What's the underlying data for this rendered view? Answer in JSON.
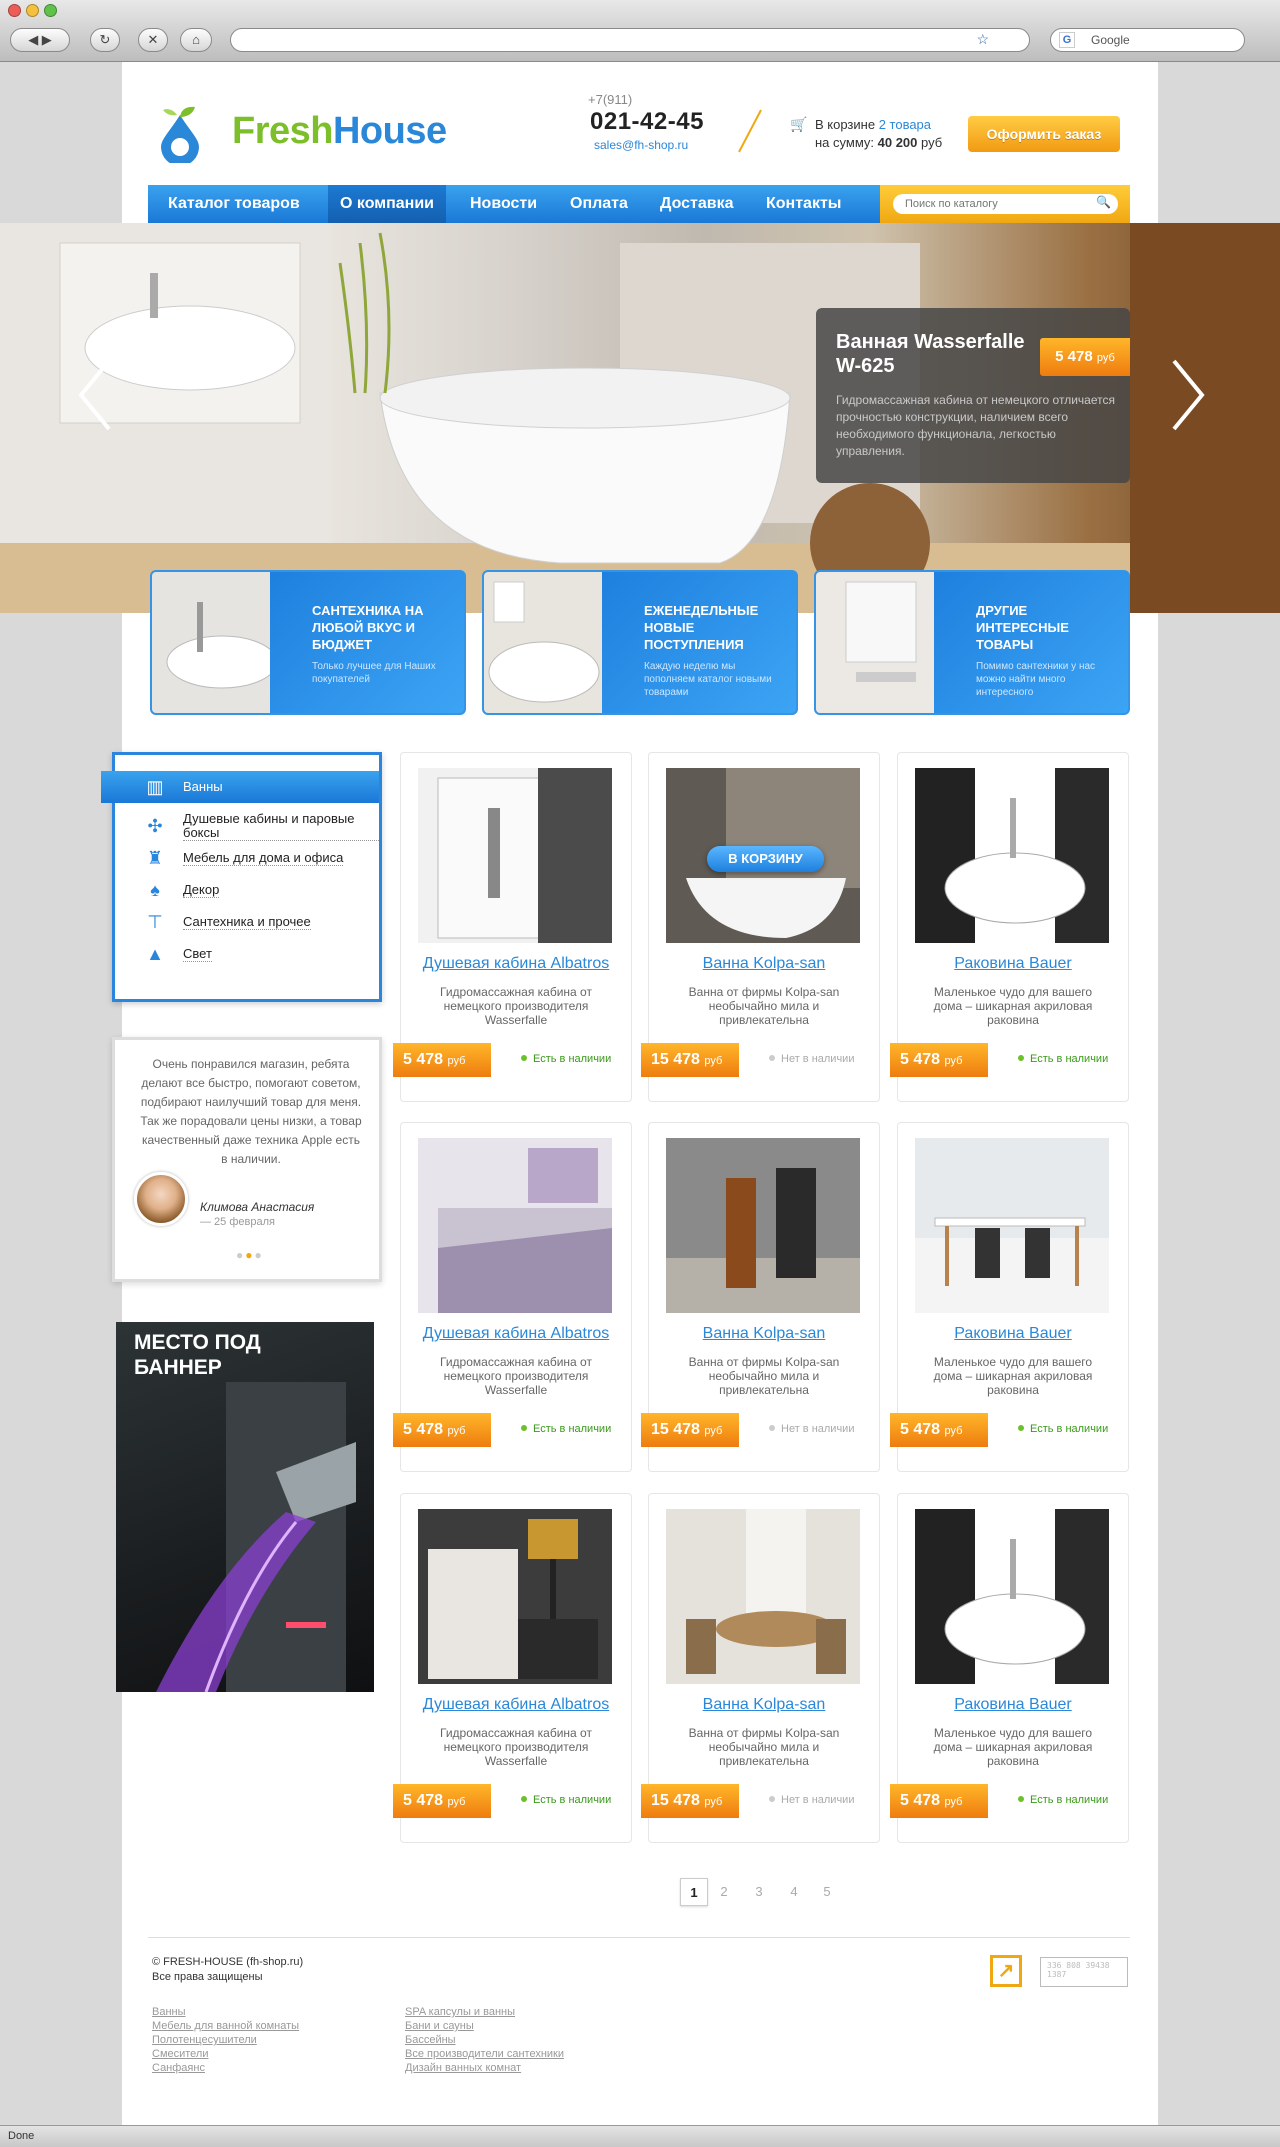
{
  "browser": {
    "search_placeholder": "Google",
    "status": "Done"
  },
  "header": {
    "logo_fresh": "Fresh",
    "logo_house": "House",
    "phone_prefix": "+7(911)",
    "phone": "021-42-45",
    "email": "sales@fh-shop.ru",
    "cart_line1_prefix": "В корзине ",
    "cart_items": "2 товара",
    "cart_line2_prefix": "на сумму: ",
    "cart_sum": "40 200",
    "cart_currency": " руб",
    "order_button": "Оформить заказ"
  },
  "nav": {
    "items": [
      {
        "label": "Каталог товаров"
      },
      {
        "label": "О компании"
      },
      {
        "label": "Новости"
      },
      {
        "label": "Оплата"
      },
      {
        "label": "Доставка"
      },
      {
        "label": "Контакты"
      }
    ],
    "active": "О компании",
    "search_placeholder": "Поиск по каталогу"
  },
  "hero": {
    "title": "Ванная Wasserfalle W-625",
    "price": "5 478",
    "currency": "руб",
    "description": "Гидромассажная кабина от немецкого отличается прочностью конструкции, наличием всего необходимого функционала, легкостью управления."
  },
  "tiles": [
    {
      "title": "Сантехника на любой вкус и бюджет",
      "subtitle": "Только лучшее для Наших покупателей"
    },
    {
      "title": "Еженедельные новые поступления",
      "subtitle": "Каждую неделю мы пополняем каталог новыми товарами"
    },
    {
      "title": "Другие интересные товары",
      "subtitle": "Помимо сантехники у нас можно найти много интересного"
    }
  ],
  "categories": [
    {
      "label": "Ванны",
      "icon": "bath-icon"
    },
    {
      "label": "Душевые кабины и паровые боксы",
      "icon": "fan-icon"
    },
    {
      "label": "Мебель для дома и офиса",
      "icon": "chair-icon"
    },
    {
      "label": "Декор",
      "icon": "lamp-icon"
    },
    {
      "label": "Сантехника и прочее",
      "icon": "faucet-icon"
    },
    {
      "label": "Свет",
      "icon": "light-icon"
    }
  ],
  "review": {
    "text": "Очень понравился магазин, ребята делают все быстро, помогают советом, подбирают наилучший товар для меня. Так же порадовали цены низки, а товар качественный даже техника Apple есть в наличии.",
    "name": "Климова Анастасия",
    "date": "— 25 февраля"
  },
  "banner": {
    "text": "МЕСТО ПОД БАННЕР"
  },
  "to_cart_button": "В КОРЗИНУ",
  "products": [
    {
      "name": "Душевая кабина Albatros",
      "desc": "Гидромассажная кабина от немецкого производителя Wasserfalle",
      "price": "5 478",
      "currency": "руб",
      "stock": "Есть в наличии",
      "in_stock": true
    },
    {
      "name": "Ванна Kolpa-san",
      "desc": "Ванна от фирмы Kolpa-san необычайно мила и привлекательна",
      "price": "15 478",
      "currency": "руб",
      "stock": "Нет в наличии",
      "in_stock": false
    },
    {
      "name": "Раковина Bauer",
      "desc": "Маленькое чудо для вашего дома – шикарная акриловая раковина",
      "price": "5 478",
      "currency": "руб",
      "stock": "Есть в наличии",
      "in_stock": true
    },
    {
      "name": "Душевая кабина Albatros",
      "desc": "Гидромассажная кабина от немецкого производителя Wasserfalle",
      "price": "5 478",
      "currency": "руб",
      "stock": "Есть в наличии",
      "in_stock": true
    },
    {
      "name": "Ванна Kolpa-san",
      "desc": "Ванна от фирмы Kolpa-san необычайно мила и привлекательна",
      "price": "15 478",
      "currency": "руб",
      "stock": "Нет в наличии",
      "in_stock": false
    },
    {
      "name": "Раковина Bauer",
      "desc": "Маленькое чудо для вашего дома – шикарная акриловая раковина",
      "price": "5 478",
      "currency": "руб",
      "stock": "Есть в наличии",
      "in_stock": true
    },
    {
      "name": "Душевая кабина Albatros",
      "desc": "Гидромассажная кабина от немецкого производителя Wasserfalle",
      "price": "5 478",
      "currency": "руб",
      "stock": "Есть в наличии",
      "in_stock": true
    },
    {
      "name": "Ванна Kolpa-san",
      "desc": "Ванна от фирмы Kolpa-san необычайно мила и привлекательна",
      "price": "15 478",
      "currency": "руб",
      "stock": "Нет в наличии",
      "in_stock": false
    },
    {
      "name": "Раковина Bauer",
      "desc": "Маленькое чудо для вашего дома – шикарная акриловая раковина",
      "price": "5 478",
      "currency": "руб",
      "stock": "Есть в наличии",
      "in_stock": true
    }
  ],
  "pagination": [
    "1",
    "2",
    "3",
    "4",
    "5"
  ],
  "pagination_active": "1",
  "footer": {
    "copyright_line1": "© FRESH-HOUSE (fh-shop.ru)",
    "copyright_line2": "Все права защищены",
    "col1": [
      "Ванны",
      "Мебель для ванной комнаты",
      "Полотенцесушители",
      "Смесители",
      "Санфаянс"
    ],
    "col2": [
      "SPA капсулы и ванны",
      "Бани и сауны",
      "Бассейны",
      "Все производители сантехники",
      "Дизайн ванных комнат"
    ],
    "studio_code": "336 808 39438 1387"
  },
  "colors": {
    "brand_green": "#7cbf2a",
    "brand_blue": "#2b88d8",
    "accent_orange": "#f29a12"
  }
}
